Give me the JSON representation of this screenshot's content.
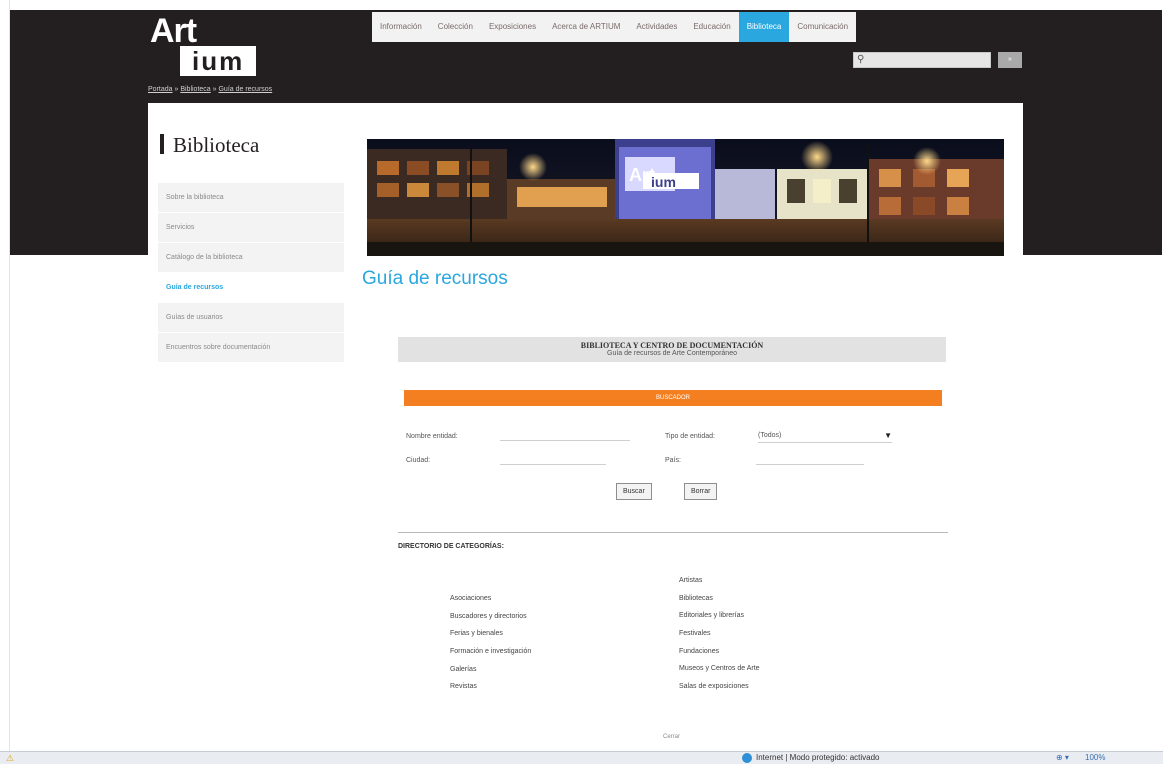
{
  "logo": {
    "top": "Art",
    "bottom": "ium"
  },
  "nav": {
    "items": [
      {
        "label": "Información",
        "active": false
      },
      {
        "label": "Colección",
        "active": false
      },
      {
        "label": "Exposiciones",
        "active": false
      },
      {
        "label": "Acerca de ARTIUM",
        "active": false
      },
      {
        "label": "Actividades",
        "active": false
      },
      {
        "label": "Educación",
        "active": false
      },
      {
        "label": "Biblioteca",
        "active": true
      },
      {
        "label": "Comunicación",
        "active": false
      }
    ],
    "accent": "#2aa7de"
  },
  "search": {
    "button": "»"
  },
  "breadcrumb": {
    "home": "Portada",
    "section": "Biblioteca",
    "current": "Guía de recursos",
    "sep": " » "
  },
  "section": {
    "title": "Biblioteca"
  },
  "sidebar": {
    "items": [
      {
        "label": "Sobre la biblioteca",
        "active": false
      },
      {
        "label": "Servicios",
        "active": false
      },
      {
        "label": "Catálogo de la biblioteca",
        "active": false
      },
      {
        "label": "Guía de recursos",
        "active": true
      },
      {
        "label": "Guías de usuarios",
        "active": false
      },
      {
        "label": "Encuentros sobre documentación",
        "active": false
      }
    ]
  },
  "main": {
    "title": "Guía de recursos",
    "box_title": "BIBLIOTECA Y CENTRO DE DOCUMENTACIÓN",
    "box_subtitle": "Guía de recursos de Arte Contemporáneo",
    "orange_bar": "BUSCADOR",
    "orange_color": "#f47f20"
  },
  "form": {
    "nombre_label": "Nombre entidad:",
    "tipo_label": "Tipo de entidad:",
    "tipo_value": "(Todos)",
    "ciudad_label": "Ciudad:",
    "pais_label": "País:",
    "buscar": "Buscar",
    "borrar": "Borrar"
  },
  "directory": {
    "title": "DIRECTORIO DE CATEGORÍAS:",
    "left": [
      "Asociaciones",
      "Buscadores y directorios",
      "Ferias y bienales",
      "Formación e investigación",
      "Galerías",
      "Revistas"
    ],
    "right": [
      "Artistas",
      "Bibliotecas",
      "Editoriales y librerías",
      "Festivales",
      "Fundaciones",
      "Museos y Centros de Arte",
      "Salas de exposiciones"
    ]
  },
  "footer": {
    "link": "Cerrar"
  },
  "status": {
    "text": "Internet | Modo protegido: activado",
    "zoom": "100%",
    "zoom_ctrl": "⊕ ▾"
  }
}
